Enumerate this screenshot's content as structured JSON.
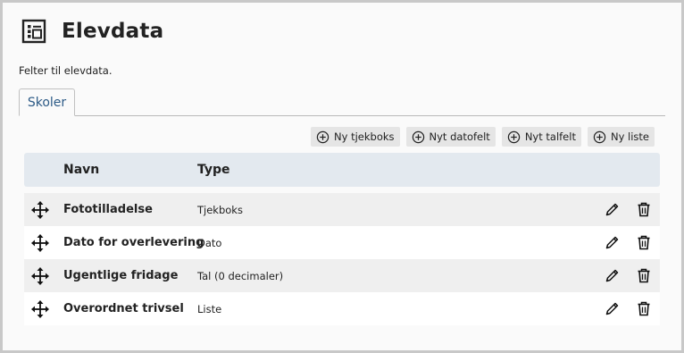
{
  "page": {
    "title": "Elevdata",
    "description": "Felter til elevdata.",
    "header_icon": "list-form-icon"
  },
  "tabs": [
    {
      "label": "Skoler",
      "active": true
    }
  ],
  "toolbar": {
    "buttons": [
      {
        "label": "Ny tjekboks",
        "icon": "plus-circle-icon"
      },
      {
        "label": "Nyt datofelt",
        "icon": "plus-circle-icon"
      },
      {
        "label": "Nyt talfelt",
        "icon": "plus-circle-icon"
      },
      {
        "label": "Ny liste",
        "icon": "plus-circle-icon"
      }
    ]
  },
  "table": {
    "columns": {
      "name": "Navn",
      "type": "Type"
    },
    "rows": [
      {
        "name": "Fototilladelse",
        "type": "Tjekboks"
      },
      {
        "name": "Dato for overlevering",
        "type": "Dato"
      },
      {
        "name": "Ugentlige fridage",
        "type": "Tal (0 decimaler)"
      },
      {
        "name": "Overordnet trivsel",
        "type": "Liste"
      }
    ]
  },
  "colors": {
    "tab_text": "#2c5a86",
    "header_bg": "#e3e9ef",
    "row_odd": "#efefef",
    "button_bg": "#e5e5e5"
  }
}
